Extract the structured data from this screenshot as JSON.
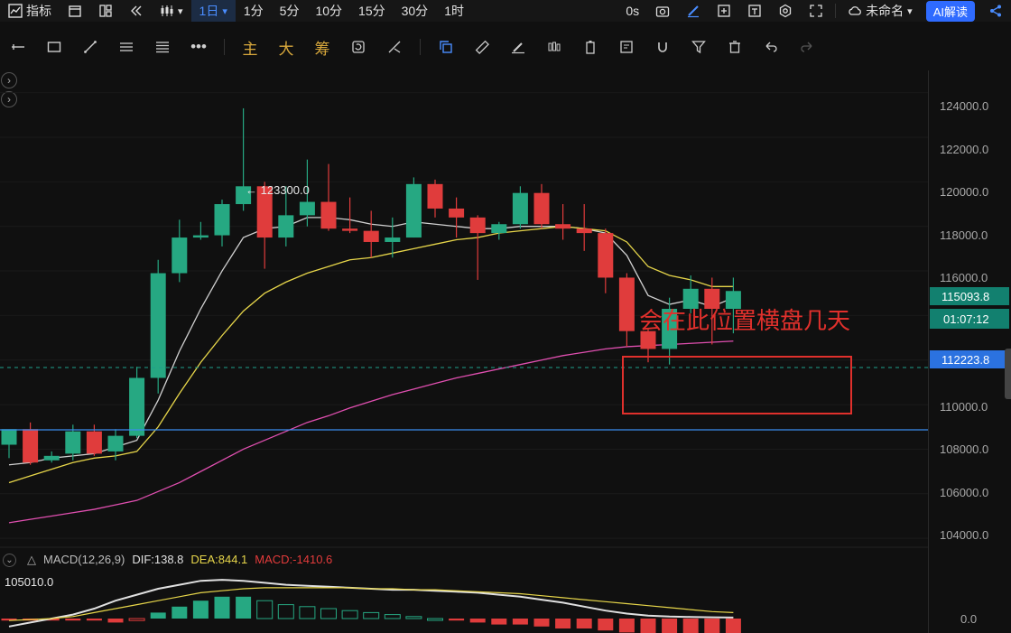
{
  "topbar": {
    "indicator_label": "指标",
    "period_active": "1日",
    "periods": [
      "1分",
      "5分",
      "10分",
      "15分",
      "30分",
      "1时"
    ],
    "timer": "0s",
    "layout_name": "未命名",
    "ai_label": "AI解读"
  },
  "toolbar": {
    "gold_tools": [
      "主",
      "大",
      "筹"
    ]
  },
  "annotations": {
    "box_note": "会在此位置横盘几天",
    "high_label": "← 123300.0",
    "low_label": "105010.0"
  },
  "price_axis": {
    "ticks": [
      "124000.0",
      "122000.0",
      "120000.0",
      "118000.0",
      "116000.0",
      "110000.0",
      "108000.0",
      "106000.0",
      "104000.0"
    ],
    "current_price": "115093.8",
    "countdown": "01:07:12",
    "blue_line_price": "112223.8",
    "macd_zero": "0.0"
  },
  "macd": {
    "name": "MACD(12,26,9)",
    "dif": "DIF:138.8",
    "dea": "DEA:844.1",
    "macd_val": "MACD:-1410.6"
  },
  "colors": {
    "up": "#26a882",
    "down": "#e03c3c",
    "ma_white": "#d0d0d0",
    "ma_yellow": "#e7d64a",
    "ma_pink": "#e04fb0",
    "blue_line": "#3a8df0",
    "box": "#e0302c"
  },
  "chart_data": {
    "type": "candlestick",
    "series": [
      {
        "o": 108200,
        "h": 108700,
        "l": 107600,
        "c": 108900
      },
      {
        "o": 108900,
        "h": 109200,
        "l": 107300,
        "c": 107400
      },
      {
        "o": 107500,
        "h": 107900,
        "l": 107400,
        "c": 107700
      },
      {
        "o": 107800,
        "h": 109100,
        "l": 107500,
        "c": 108800
      },
      {
        "o": 108800,
        "h": 109100,
        "l": 107700,
        "c": 107800
      },
      {
        "o": 107900,
        "h": 108900,
        "l": 107500,
        "c": 108600
      },
      {
        "o": 108600,
        "h": 111700,
        "l": 108500,
        "c": 111200
      },
      {
        "o": 111200,
        "h": 116500,
        "l": 110500,
        "c": 115900
      },
      {
        "o": 115900,
        "h": 118300,
        "l": 115500,
        "c": 117500
      },
      {
        "o": 117500,
        "h": 118200,
        "l": 117400,
        "c": 117600
      },
      {
        "o": 117600,
        "h": 119200,
        "l": 117100,
        "c": 119000
      },
      {
        "o": 119000,
        "h": 123300,
        "l": 118700,
        "c": 119800
      },
      {
        "o": 119800,
        "h": 120000,
        "l": 116100,
        "c": 117500
      },
      {
        "o": 117500,
        "h": 119800,
        "l": 117100,
        "c": 118500
      },
      {
        "o": 118500,
        "h": 121000,
        "l": 118000,
        "c": 119100
      },
      {
        "o": 119100,
        "h": 120800,
        "l": 117800,
        "c": 117900
      },
      {
        "o": 117900,
        "h": 119300,
        "l": 117700,
        "c": 117800
      },
      {
        "o": 117800,
        "h": 118700,
        "l": 116600,
        "c": 117300
      },
      {
        "o": 117300,
        "h": 118400,
        "l": 116600,
        "c": 117500
      },
      {
        "o": 117500,
        "h": 120200,
        "l": 117500,
        "c": 119900
      },
      {
        "o": 119900,
        "h": 120100,
        "l": 118400,
        "c": 118800
      },
      {
        "o": 118800,
        "h": 119300,
        "l": 117500,
        "c": 118400
      },
      {
        "o": 118400,
        "h": 118500,
        "l": 115600,
        "c": 117700
      },
      {
        "o": 117700,
        "h": 118200,
        "l": 117400,
        "c": 118100
      },
      {
        "o": 118100,
        "h": 119800,
        "l": 117900,
        "c": 119500
      },
      {
        "o": 119500,
        "h": 119900,
        "l": 117900,
        "c": 118100
      },
      {
        "o": 118100,
        "h": 119000,
        "l": 117400,
        "c": 117900
      },
      {
        "o": 117900,
        "h": 119000,
        "l": 116900,
        "c": 117700
      },
      {
        "o": 117700,
        "h": 117900,
        "l": 115000,
        "c": 115700
      },
      {
        "o": 115700,
        "h": 115900,
        "l": 112600,
        "c": 113300
      },
      {
        "o": 113300,
        "h": 113400,
        "l": 111900,
        "c": 112500
      },
      {
        "o": 112500,
        "h": 114800,
        "l": 111800,
        "c": 114300
      },
      {
        "o": 114300,
        "h": 115800,
        "l": 114100,
        "c": 115200
      },
      {
        "o": 115200,
        "h": 115700,
        "l": 112700,
        "c": 114300
      },
      {
        "o": 114300,
        "h": 115700,
        "l": 113200,
        "c": 115100
      }
    ],
    "ma_white": [
      107300,
      107400,
      107600,
      107700,
      107800,
      108100,
      108400,
      110200,
      112400,
      114300,
      116000,
      117500,
      117900,
      118000,
      118400,
      118400,
      118300,
      118100,
      118000,
      118200,
      118100,
      118000,
      117900,
      117900,
      118000,
      118000,
      118000,
      117900,
      117700,
      116700,
      114900,
      114500,
      114700,
      114400,
      114800
    ],
    "ma_yellow": [
      106500,
      106800,
      107100,
      107400,
      107600,
      107700,
      107900,
      109000,
      110500,
      111900,
      113100,
      114200,
      115000,
      115500,
      115900,
      116200,
      116500,
      116600,
      116800,
      117000,
      117200,
      117400,
      117500,
      117700,
      117800,
      117900,
      118000,
      117900,
      117800,
      117300,
      116200,
      115800,
      115600,
      115300,
      115300
    ],
    "ma_pink": [
      104700,
      104850,
      105000,
      105150,
      105300,
      105500,
      105700,
      106100,
      106500,
      107000,
      107500,
      108000,
      108400,
      108800,
      109200,
      109500,
      109850,
      110150,
      110450,
      110700,
      110950,
      111200,
      111400,
      111600,
      111800,
      112000,
      112200,
      112350,
      112500,
      112600,
      112650,
      112700,
      112750,
      112800,
      112850
    ],
    "ylim": [
      103600,
      125000
    ],
    "macd_histogram": [
      -0.1,
      -0.1,
      -0.1,
      -0.1,
      -0.1,
      -0.2,
      -0.1,
      0.3,
      0.6,
      0.9,
      1.1,
      1.1,
      0.9,
      0.7,
      0.6,
      0.5,
      0.4,
      0.3,
      0.2,
      0.1,
      0.0,
      -0.1,
      -0.2,
      -0.3,
      -0.3,
      -0.4,
      -0.5,
      -0.5,
      -0.6,
      -0.7,
      -0.8,
      -0.8,
      -0.8,
      -0.8,
      -0.8
    ],
    "macd_dif": [
      -0.4,
      -0.2,
      0.0,
      0.2,
      0.5,
      0.9,
      1.2,
      1.5,
      1.7,
      1.9,
      1.95,
      1.9,
      1.8,
      1.7,
      1.65,
      1.6,
      1.55,
      1.5,
      1.45,
      1.45,
      1.4,
      1.35,
      1.3,
      1.2,
      1.1,
      0.95,
      0.8,
      0.6,
      0.4,
      0.25,
      0.15,
      0.1,
      0.08,
      0.06,
      0.05
    ],
    "macd_dea": [
      -0.1,
      -0.05,
      0.0,
      0.1,
      0.3,
      0.5,
      0.7,
      0.9,
      1.1,
      1.3,
      1.4,
      1.5,
      1.55,
      1.55,
      1.55,
      1.55,
      1.55,
      1.5,
      1.5,
      1.45,
      1.45,
      1.4,
      1.35,
      1.3,
      1.25,
      1.15,
      1.05,
      0.95,
      0.85,
      0.75,
      0.65,
      0.55,
      0.45,
      0.35,
      0.3
    ]
  }
}
